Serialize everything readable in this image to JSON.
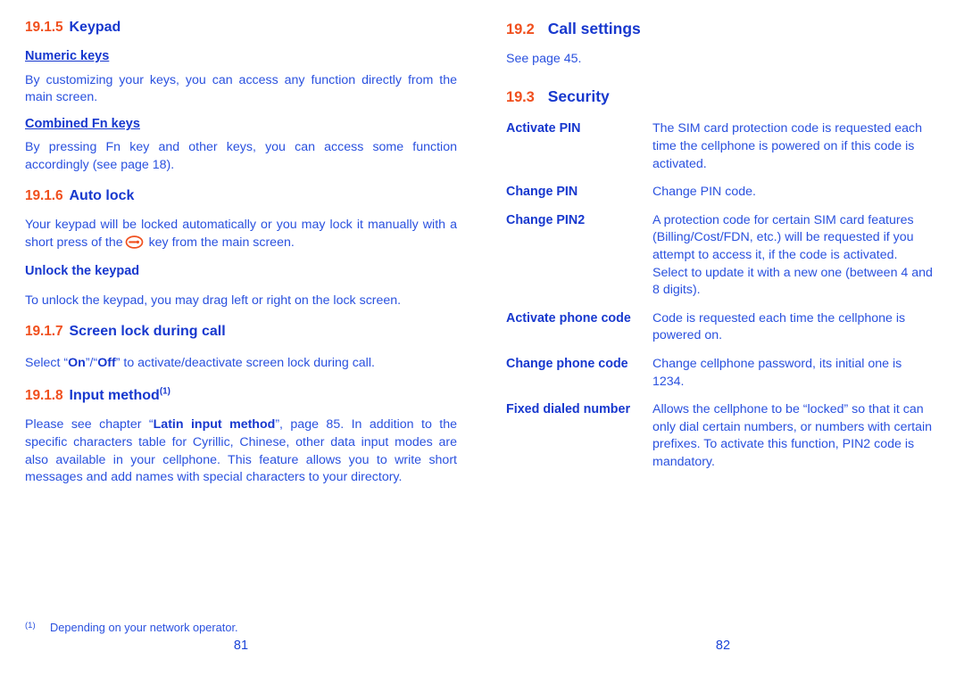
{
  "colors": {
    "accent_orange": "#F0501E",
    "heading_blue": "#1738CE",
    "body_blue": "#2A51DF"
  },
  "left_column": {
    "sections": [
      {
        "number": "19.1.5",
        "title": "Keypad",
        "blocks": [
          {
            "kind": "subhead_underline",
            "text": "Numeric keys"
          },
          {
            "kind": "paragraph",
            "text": "By customizing your keys, you can access any function directly from the main screen."
          },
          {
            "kind": "subhead_underline",
            "text": "Combined Fn keys"
          },
          {
            "kind": "paragraph",
            "text": "By pressing Fn key and other keys, you can access some function accordingly (see page 18)."
          }
        ]
      },
      {
        "number": "19.1.6",
        "title": "Auto lock",
        "blocks": [
          {
            "kind": "paragraph_with_key_icon",
            "text_before": "Your keypad will be locked automatically or you may lock it manually with a short press of the",
            "icon": "lock-key-icon",
            "text_after": "key from the main screen."
          },
          {
            "kind": "subhead",
            "text": "Unlock the keypad"
          },
          {
            "kind": "paragraph",
            "text": "To unlock the keypad, you may drag left or right on the lock screen."
          }
        ]
      },
      {
        "number": "19.1.7",
        "title": "Screen lock during call",
        "blocks": [
          {
            "kind": "paragraph_rich",
            "segments": [
              {
                "text": "Select “"
              },
              {
                "text": "On",
                "bold": true
              },
              {
                "text": "”/“"
              },
              {
                "text": "Off",
                "bold": true
              },
              {
                "text": "” to activate/deactivate screen lock during call."
              }
            ]
          }
        ]
      },
      {
        "number": "19.1.8",
        "title": "Input method",
        "footnote_marker": "(1)",
        "blocks": [
          {
            "kind": "paragraph_rich",
            "segments": [
              {
                "text": "Please see chapter “"
              },
              {
                "text": "Latin input method",
                "bold": true
              },
              {
                "text": "”, page 85. In addition to the specific characters table for Cyrillic, Chinese, other data input modes are also available in your cellphone. This feature allows you to write short messages and add names with special characters to your directory."
              }
            ]
          }
        ]
      }
    ]
  },
  "right_column": {
    "sections": [
      {
        "number": "19.2",
        "title": "Call settings",
        "major": true,
        "blocks": [
          {
            "kind": "paragraph",
            "text": "See page 45."
          }
        ]
      },
      {
        "number": "19.3",
        "title": "Security",
        "major": true,
        "definitions": [
          {
            "term": "Activate PIN",
            "desc": "The SIM card protection code is requested each time the cellphone is powered on if this code is activated."
          },
          {
            "term": "Change PIN",
            "desc": "Change PIN code."
          },
          {
            "term": "Change PIN2",
            "desc": "A protection code for certain SIM card features (Billing/Cost/FDN, etc.) will be requested if you attempt to access it, if the code is activated. Select to update it with a new one (between 4 and 8 digits)."
          },
          {
            "term": "Activate phone code",
            "desc": "Code is requested each time the cellphone is powered on."
          },
          {
            "term": "Change phone code",
            "desc": "Change cellphone password, its initial one is 1234."
          },
          {
            "term": "Fixed dialed number",
            "desc": "Allows the cellphone to be “locked” so that it can only dial certain numbers, or numbers with certain prefixes. To activate this function, PIN2 code is mandatory."
          }
        ]
      }
    ]
  },
  "footnote": {
    "marker": "(1)",
    "text": "Depending on your network operator."
  },
  "page_numbers": {
    "left": "81",
    "right": "82"
  }
}
